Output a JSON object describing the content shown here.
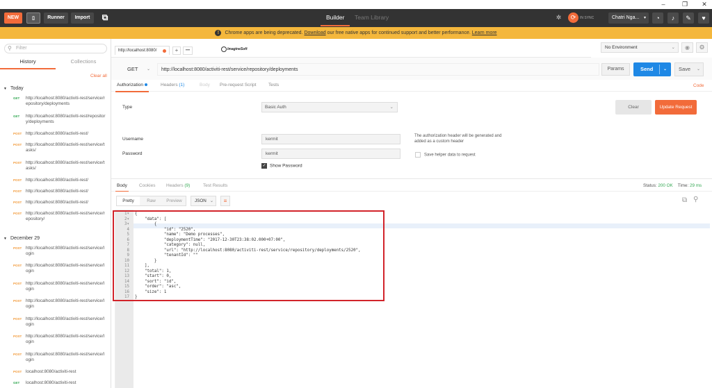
{
  "header": {
    "new_label": "NEW",
    "runner_label": "Runner",
    "import_label": "Import",
    "tabs": [
      "Builder",
      "Team Library"
    ],
    "sync_label": "IN SYNC",
    "user_name": "Chatri Nga..."
  },
  "banner": {
    "text_before": "Chrome apps are being deprecated.",
    "link1": "Download",
    "text_middle": "our free native apps for continued support and better performance.",
    "link2": "Learn more"
  },
  "sidebar": {
    "filter_placeholder": "Filter",
    "tabs": [
      "History",
      "Collections"
    ],
    "clear_all": "Clear all",
    "groups": [
      {
        "label": "Today",
        "items": [
          {
            "method": "GET",
            "url": "http://localhost:8080/activiti-rest/service/repository/deployments"
          },
          {
            "method": "GET",
            "url": "http://localhost:8080/activiti-rest/repository/deployments"
          },
          {
            "method": "POST",
            "url": "http://localhost:8080/activiti-rest/"
          },
          {
            "method": "POST",
            "url": "http://localhost:8080/activiti-rest/service/tasks/"
          },
          {
            "method": "POST",
            "url": "http://localhost:8080/activiti-rest/service/tasks/"
          },
          {
            "method": "POST",
            "url": "http://localhost:8080/activiti-rest/"
          },
          {
            "method": "POST",
            "url": "http://localhost:8080/activiti-rest/"
          },
          {
            "method": "POST",
            "url": "http://localhost:8080/activiti-rest/"
          },
          {
            "method": "POST",
            "url": "http://localhost:8080/activiti-rest/service/repository/"
          }
        ]
      },
      {
        "label": "December 29",
        "items": [
          {
            "method": "POST",
            "url": "http://localhost:8080/activiti-rest/service/login"
          },
          {
            "method": "POST",
            "url": "http://localhost:8080/activiti-rest/service/login"
          },
          {
            "method": "POST",
            "url": "http://localhost:8080/activiti-rest/service/login"
          },
          {
            "method": "POST",
            "url": "http://localhost:8080/activiti-rest/service/login"
          },
          {
            "method": "POST",
            "url": "http://localhost:8080/activiti-rest/service/login"
          },
          {
            "method": "POST",
            "url": "http://localhost:8080/activiti-rest/service/login"
          },
          {
            "method": "POST",
            "url": "http://localhost:8080/activiti-rest/service/login"
          },
          {
            "method": "POST",
            "url": "localhost:8080/activiti-rest"
          },
          {
            "method": "GET",
            "url": "localhost:8080/activiti-rest"
          }
        ]
      }
    ]
  },
  "request_tabs": {
    "tab1_label": "http://localhost:8080/",
    "plus": "+",
    "more": "•••",
    "logo_text": "ImagineSoft"
  },
  "environment": {
    "selected": "No Environment"
  },
  "request": {
    "method": "GET",
    "url": "http://localhost:8080/activiti-rest/service/repository/deployments",
    "params_label": "Params",
    "send_label": "Send",
    "save_label": "Save",
    "tabs": [
      "Authorization",
      "Headers",
      "Body",
      "Pre-request Script",
      "Tests"
    ],
    "headers_count": "(1)",
    "code_link": "Code"
  },
  "auth": {
    "type_label": "Type",
    "type_value": "Basic Auth",
    "clear_label": "Clear",
    "update_label": "Update Request",
    "username_label": "Username",
    "username_value": "kermit",
    "password_label": "Password",
    "password_value": "kermit",
    "note": "The authorization header will be generated and added as a custom header",
    "save_helper": "Save helper data to request",
    "show_password": "Show Password"
  },
  "response": {
    "tabs": [
      "Body",
      "Cookies",
      "Headers",
      "Test Results"
    ],
    "headers_count": "(9)",
    "status_label": "Status:",
    "status_value": "200 OK",
    "time_label": "Time:",
    "time_value": "29 ms",
    "view_modes": [
      "Pretty",
      "Raw",
      "Preview"
    ],
    "format": "JSON",
    "lines": [
      "{",
      "    \"data\": [",
      "        {",
      "            \"id\": \"2520\",",
      "            \"name\": \"Demo processes\",",
      "            \"deploymentTime\": \"2017-12-30T23:38:02.000+07:00\",",
      "            \"category\": null,",
      "            \"url\": \"http://localhost:8080/activiti-rest/service/repository/deployments/2520\",",
      "            \"tenantId\": \"\"",
      "        }",
      "    ],",
      "    \"total\": 1,",
      "    \"start\": 0,",
      "    \"sort\": \"id\",",
      "    \"order\": \"asc\",",
      "    \"size\": 1",
      "}"
    ]
  }
}
